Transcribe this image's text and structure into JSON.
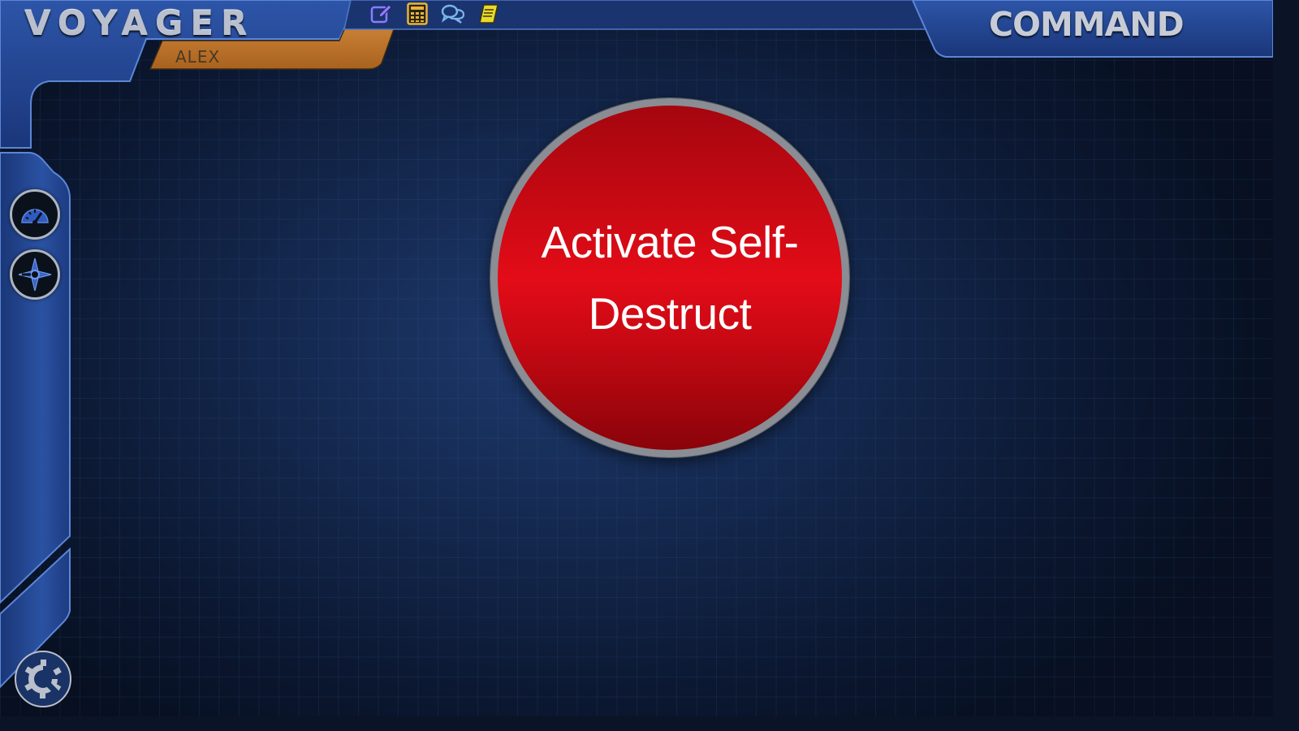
{
  "header": {
    "ship_name": "VOYAGER",
    "officer_name": "ALEX",
    "station_name": "COMMAND"
  },
  "toolbar": {
    "items": [
      {
        "name": "notes-edit",
        "icon": "pencil-square-icon",
        "color": "#8c7cff"
      },
      {
        "name": "calculator",
        "icon": "calculator-grid-icon",
        "color": "#e8b43a"
      },
      {
        "name": "messages",
        "icon": "chat-bubbles-icon",
        "color": "#7ab4e8"
      },
      {
        "name": "logbook",
        "icon": "notebook-icon",
        "color": "#e8d92c"
      }
    ]
  },
  "sidebar": {
    "items": [
      {
        "name": "engineering-gauge",
        "icon": "gauge-icon"
      },
      {
        "name": "navigation",
        "icon": "compass-star-icon"
      }
    ],
    "settings_icon": "gear-icon"
  },
  "main": {
    "self_destruct_label": "Activate Self-\nDestruct"
  },
  "colors": {
    "frame_blue": "#1e3f86",
    "frame_highlight": "#4a78c8",
    "officer_tab": "#c47a2c",
    "button_red": "#e30c18",
    "button_ring": "#8a8d93",
    "background": "#0b1730"
  }
}
